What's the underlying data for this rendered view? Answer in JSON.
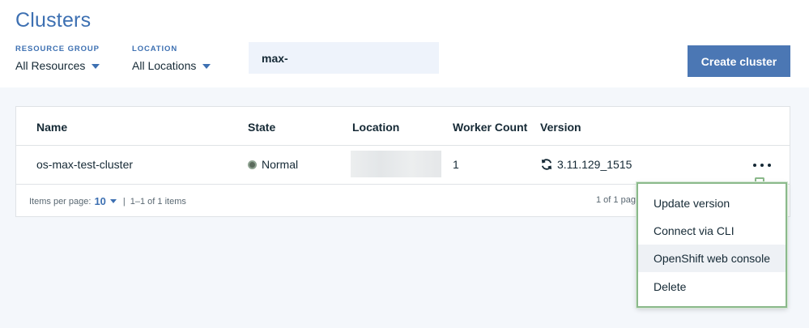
{
  "page": {
    "title": "Clusters"
  },
  "filters": {
    "resource_group": {
      "label": "RESOURCE GROUP",
      "value": "All Resources"
    },
    "location": {
      "label": "LOCATION",
      "value": "All Locations"
    }
  },
  "search": {
    "value": "max-"
  },
  "actions": {
    "create_label": "Create cluster"
  },
  "table": {
    "columns": [
      "Name",
      "State",
      "Location",
      "Worker Count",
      "Version"
    ],
    "rows": [
      {
        "name": "os-max-test-cluster",
        "state": "Normal",
        "location": "",
        "worker_count": "1",
        "version": "3.11.129_1515"
      }
    ],
    "pagination": {
      "items_per_page_label": "Items per page:",
      "items_per_page_value": "10",
      "separator": "|",
      "range": "1–1 of 1 items",
      "page_info": "1 of 1 pag"
    }
  },
  "overflow_menu": {
    "items": [
      "Update version",
      "Connect via CLI",
      "OpenShift web console",
      "Delete"
    ],
    "highlighted_index": 2
  },
  "colors": {
    "accent": "#3d70b2",
    "primary_button": "#4b77b4",
    "status_normal": "#5a6a5c",
    "menu_border": "#8bb98b"
  }
}
